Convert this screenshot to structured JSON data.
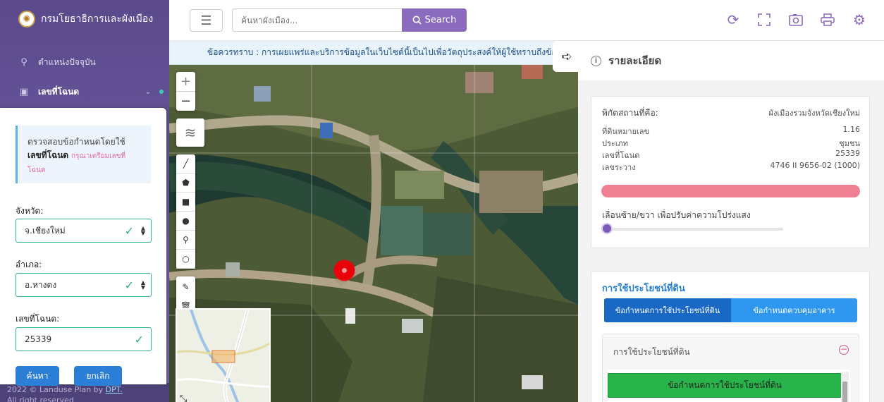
{
  "sidebar": {
    "brand": "กรมโยธาธิการและผังเมือง",
    "items": [
      {
        "label": "ตำแหน่งปัจจุบัน",
        "icon": "location-icon"
      },
      {
        "label": "เลขที่โฉนด",
        "icon": "document-icon"
      }
    ],
    "footer_text": "2022 © Landuse Plan by ",
    "footer_link": "DPT.",
    "footer_rights": "All right reserved"
  },
  "search_panel": {
    "notice_prefix": "ตรวจสอบข้อกำหนดโดยใช้",
    "notice_bold": "เลขที่โฉนด",
    "notice_hint": "กรุณาเตรียมเลขที่โฉนด",
    "province_label": "จังหวัด:",
    "province_value": "จ.เชียงใหม่",
    "district_label": "อำเภอ:",
    "district_value": "อ.หางดง",
    "deed_label": "เลขที่โฉนด:",
    "deed_value": "25339",
    "search_label": "ค้นหา",
    "cancel_label": "ยกเลิก"
  },
  "topbar": {
    "search_placeholder": "ค้นหาผังเมือง...",
    "search_button": "Search"
  },
  "marquee": "ข้อควรทราบ : การเผยแพร่และบริการข้อมูลในเว็บไซต์นี้เป็นไปเพื่อวัตถุประสงค์ให้ผู้ใช้ทราบถึงข้อมูลเบื้อง",
  "detail": {
    "title": "รายละเอียด",
    "location_label": "พิกัดสถานที่คือ:",
    "location_value": "ผังเมืองรวมจังหวัดเชียงใหม่",
    "rows": [
      {
        "label": "ที่ดินหมายเลข",
        "value": "1.16"
      },
      {
        "label": "ประเภท",
        "value": "ชุมชน"
      },
      {
        "label": "เลขที่โฉนด",
        "value": "25339"
      },
      {
        "label": "เลขระวาง",
        "value": "4746 II 9656-02 (1000)"
      }
    ],
    "zone_color": "#ef7f92",
    "slider_label": "เลื่อนซ้าย/ขวา เพื่อปรับค่าความโปร่งแสง",
    "opacity_value": 0,
    "landuse_title": "การใช้ประโยชน์ที่ดิน",
    "tab_active": "ข้อกำหนดการใช้ประโยชน์ที่ดิน",
    "tab_other": "ข้อกำหนดควบคุมอาคาร",
    "accordion_title": "การใช้ประโยชน์ที่ดิน",
    "table_header": "ข้อกำหนดการใช้ประโยชน์ที่ดิน"
  },
  "colors": {
    "accent": "#8b6bbd",
    "sidebar": "#5a4a8c",
    "field_border": "#2fb389",
    "marker": "#e8000a",
    "tab_active": "#1868c4",
    "tab_other": "#2f97ef",
    "table_header": "#28b44a"
  }
}
